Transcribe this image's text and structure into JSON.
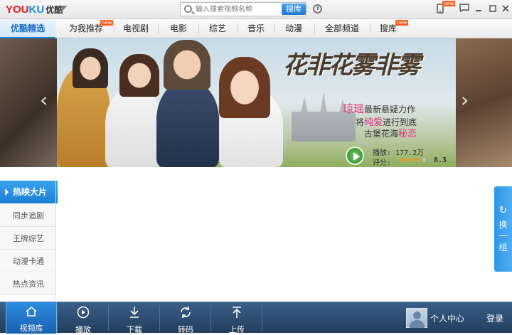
{
  "app": {
    "logo_latin": "YOUKU",
    "logo_cn": "优酷",
    "new_badge": "new"
  },
  "search": {
    "placeholder": "输入搜索视频名称",
    "button": "搜库"
  },
  "nav": {
    "items": [
      {
        "label": "优酷精选",
        "active": true
      },
      {
        "label": "为我推荐"
      },
      {
        "label": "电视剧"
      },
      {
        "label": "电影"
      },
      {
        "label": "综艺"
      },
      {
        "label": "音乐"
      },
      {
        "label": "动漫"
      },
      {
        "label": "全部频道"
      },
      {
        "label": "搜库"
      }
    ]
  },
  "banner": {
    "title": "花非花雾非雾",
    "line1_pink": "琼瑶",
    "line1_rest": "最新悬疑力作",
    "line2_a": "将",
    "line2_pink": "纯爱",
    "line2_b": "进行到底",
    "line3_a": "古堡花海",
    "line3_pink": "秘恋",
    "plays_label": "播放:",
    "plays_value": "177.2万",
    "rating_label": "评分:",
    "rating_value": "8.3",
    "rating_stars": 4.15
  },
  "sidebar": {
    "active": "热映大片",
    "items": [
      "同步追剧",
      "王牌综艺",
      "动漫卡通",
      "热点资讯"
    ]
  },
  "refresh": {
    "label_1": "换",
    "label_2": "一",
    "label_3": "组"
  },
  "bottom": {
    "tools": [
      {
        "label": "视频库",
        "icon": "home-icon",
        "active": true
      },
      {
        "label": "播放",
        "icon": "play-circle-icon"
      },
      {
        "label": "下载",
        "icon": "download-icon"
      },
      {
        "label": "转码",
        "icon": "convert-icon"
      },
      {
        "label": "上传",
        "icon": "upload-icon"
      }
    ],
    "user_center": "个人中心",
    "login": "登录"
  },
  "colors": {
    "accent": "#1b7fd5",
    "bottom_bar": "#2b4b70",
    "badge": "#ff5a1a",
    "pink": "#e0327a"
  }
}
